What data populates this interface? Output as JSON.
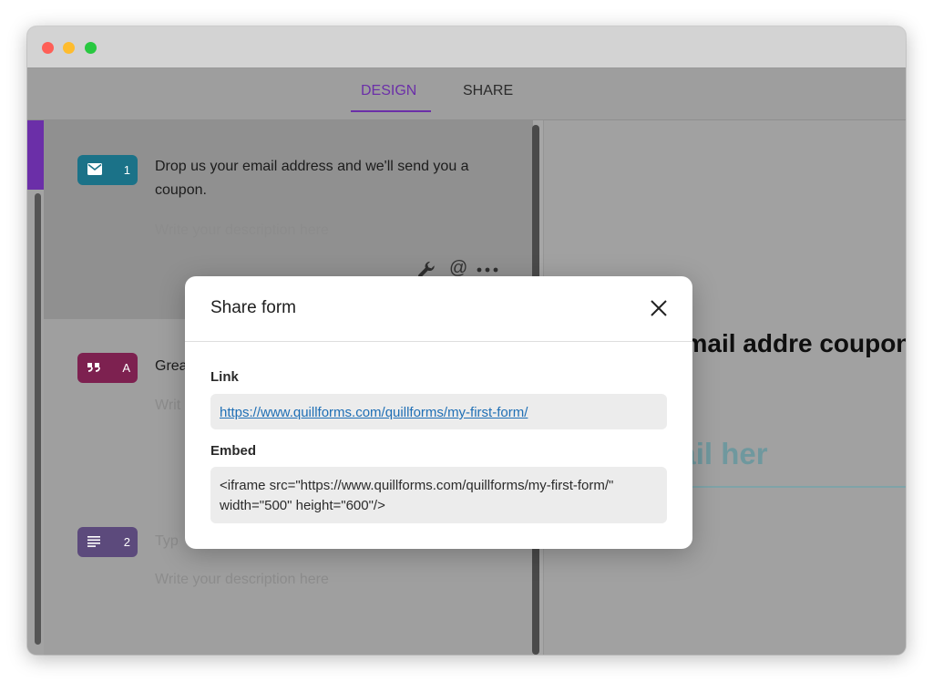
{
  "topnav": {
    "tabs": [
      {
        "label": "DESIGN"
      },
      {
        "label": "SHARE"
      }
    ]
  },
  "blocks": [
    {
      "number": "1",
      "icon": "mail-icon",
      "title": "Drop us your email address and we'll send you a coupon.",
      "description_placeholder": "Write your description here"
    },
    {
      "number": "A",
      "icon": "quote-icon",
      "title": "Grea",
      "description_placeholder": "Writ"
    },
    {
      "number": "2",
      "icon": "text-lines-icon",
      "title": "Typ",
      "description_placeholder": "Write your description here"
    }
  ],
  "preview": {
    "title": "us your email addre coupon.",
    "input_placeholder": "your email her"
  },
  "modal": {
    "title": "Share form",
    "link_label": "Link",
    "link_value": "https://www.quillforms.com/quillforms/my-first-form/",
    "embed_label": "Embed",
    "embed_value": "<iframe src=\"https://www.quillforms.com/quillforms/my-first-form/\" width=\"500\" height=\"600\"/>"
  },
  "colors": {
    "accent": "#6b2fa8",
    "badge_email": "#1b7288",
    "badge_statement": "#7d2150",
    "badge_text": "#5c4a7c",
    "link": "#1f6fb5"
  }
}
